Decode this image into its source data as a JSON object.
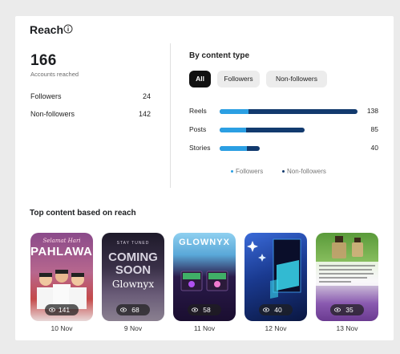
{
  "reach": {
    "title": "Reach",
    "accounts_reached": "166",
    "accounts_reached_label": "Accounts reached",
    "stats": [
      {
        "label": "Followers",
        "value": "24"
      },
      {
        "label": "Non-followers",
        "value": "142"
      }
    ]
  },
  "content_type": {
    "title": "By content type",
    "filters": [
      {
        "label": "All",
        "active": true
      },
      {
        "label": "Followers",
        "active": false
      },
      {
        "label": "Non-followers",
        "active": false
      }
    ],
    "rows": [
      {
        "label": "Reels",
        "value": "138",
        "followers_fraction": 0.21
      },
      {
        "label": "Posts",
        "value": "85",
        "followers_fraction": 0.31
      },
      {
        "label": "Stories",
        "value": "40",
        "followers_fraction": 0.68
      }
    ],
    "max_value": 138,
    "legend": {
      "followers": "Followers",
      "non_followers": "Non-followers"
    },
    "colors": {
      "followers": "#2b9fe3",
      "non_followers": "#123a6e"
    }
  },
  "top_content": {
    "title": "Top content based on reach",
    "items": [
      {
        "reach": "141",
        "date": "10 Nov",
        "line1": "Selamat Hari",
        "line2": "PAHLAWAN"
      },
      {
        "reach": "68",
        "date": "9 Nov",
        "line1": "STAY TUNED",
        "line2": "COMING",
        "line3": "SOON",
        "line4": "Glownyx"
      },
      {
        "reach": "58",
        "date": "11 Nov",
        "line1": "GLOWNYX"
      },
      {
        "reach": "40",
        "date": "12 Nov"
      },
      {
        "reach": "35",
        "date": "13 Nov"
      }
    ]
  }
}
